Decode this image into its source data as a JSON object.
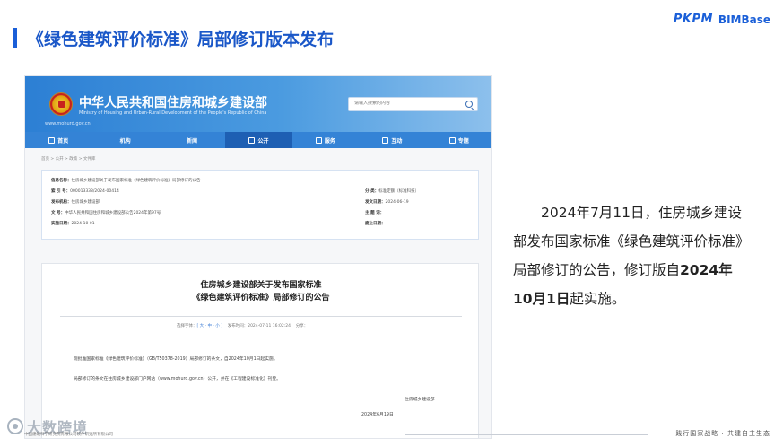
{
  "slide": {
    "title": "《绿色建筑评价标准》局部修订版本发布",
    "brand_logo": "PKPM",
    "brand_name": "BIMBase",
    "accent_color": "#1a5fd8"
  },
  "screenshot": {
    "header": {
      "ministry_cn": "中华人民共和国住房和城乡建设部",
      "ministry_en": "Ministry of Housing and Urban-Rural Development of the People's Republic of China",
      "site_url": "www.mohurd.gov.cn",
      "search_placeholder": "请输入搜索的内容"
    },
    "nav": [
      {
        "label": "首页",
        "icon": "home-icon"
      },
      {
        "label": "机构",
        "icon": ""
      },
      {
        "label": "新闻",
        "icon": ""
      },
      {
        "label": "公开",
        "icon": "grid-icon"
      },
      {
        "label": "服务",
        "icon": "user-icon"
      },
      {
        "label": "互动",
        "icon": "chat-icon"
      },
      {
        "label": "专题",
        "icon": "grid-icon"
      }
    ],
    "breadcrumb": "首页 > 公开 > 政策 > 文件库",
    "meta": {
      "subject_label": "信息名称：",
      "subject_value": "住房城乡建设部关于发布国家标准《绿色建筑评价标准》局部修订的公告",
      "index_label": "索 引 号：",
      "index_value": "000013338/2024-00414",
      "category_label": "分    类：",
      "category_value": "标准定额（标准科技）",
      "issuer_label": "发布机构：",
      "issuer_value": "住房城乡建设部",
      "date_label": "发文日期：",
      "date_value": "2024-06-19",
      "docno_label": "文    号：",
      "docno_value": "中华人民共和国住房和城乡建设部公告2024年第97号",
      "keywords_label": "主 题 词：",
      "effective_label": "实施日期：",
      "effective_value": "2024-10-01",
      "abolish_label": "废止日期："
    },
    "doc": {
      "title_line1": "住房城乡建设部关于发布国家标准",
      "title_line2": "《绿色建筑评价标准》局部修订的公告",
      "font_size_label": "选择字体：",
      "font_size_options": "[ 大 · 中 · 小 ]",
      "publish_label": "发布时间：",
      "publish_time": "2024-07-11 16:02:24",
      "share_label": "分享：",
      "para1": "现批准国家标准《绿色建筑评价标准》（GB/T50378-2019）局部修订的条文，自2024年10月1日起实施。",
      "para2": "局部修订的条文在住房城乡建设部门户网站（www.mohurd.gov.cn）公开，并在《工程建设标准化》刊登。",
      "signature": "住房城乡建设部",
      "sign_date": "2024年6月19日"
    },
    "copyright": "中国建筑科学研究院有限公司软件研究所有限公司"
  },
  "description": {
    "part1": "2024年7月11日，住房城乡建设部发布国家标准《绿色建筑评价标准》局部修订的公告，修订版自",
    "bold": "2024年10月1日",
    "part2": "起实施。"
  },
  "watermark": "大数跨境",
  "footer": "践行国家战略 · 共建自主生态"
}
